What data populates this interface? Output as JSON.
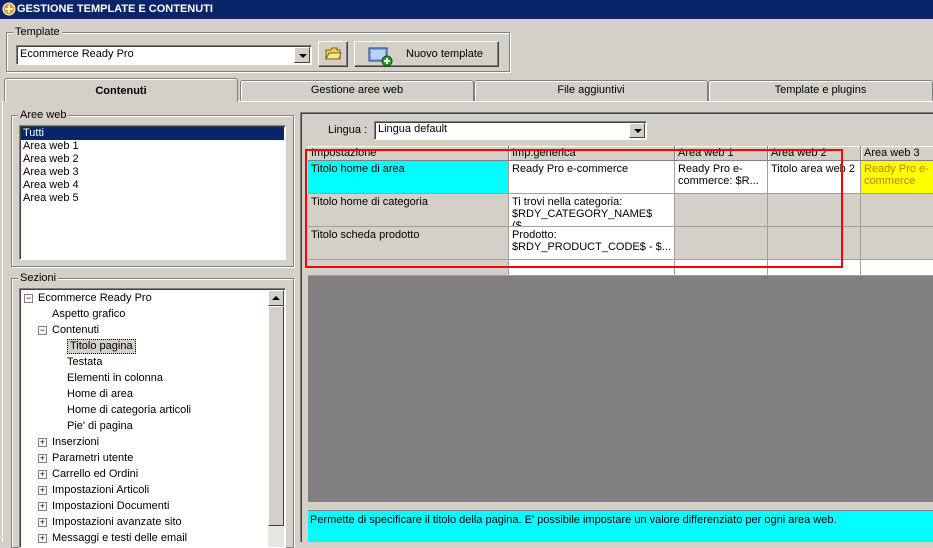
{
  "window": {
    "title": "GESTIONE TEMPLATE E CONTENUTI"
  },
  "template": {
    "group_label": "Template",
    "selected": "Ecommerce Ready Pro",
    "new_button_label": "Nuovo template"
  },
  "tabs": [
    {
      "label": "Contenuti",
      "active": true
    },
    {
      "label": "Gestione aree web",
      "active": false
    },
    {
      "label": "File aggiuntivi",
      "active": false
    },
    {
      "label": "Template e plugins",
      "active": false
    }
  ],
  "aree_web": {
    "group_label": "Aree web",
    "items": [
      "Tutti",
      "Area web 1",
      "Area web 2",
      "Area web 3",
      "Area web 4",
      "Area web 5"
    ],
    "selected_index": 0
  },
  "sezioni": {
    "group_label": "Sezioni",
    "tree": [
      {
        "label": "Ecommerce Ready Pro",
        "level": 0,
        "expander": "−"
      },
      {
        "label": "Aspetto grafico",
        "level": 1,
        "expander": ""
      },
      {
        "label": "Contenuti",
        "level": 1,
        "expander": "−"
      },
      {
        "label": "Titolo pagina",
        "level": 2,
        "expander": "",
        "selected": true
      },
      {
        "label": "Testata",
        "level": 2,
        "expander": ""
      },
      {
        "label": "Elementi in colonna",
        "level": 2,
        "expander": ""
      },
      {
        "label": "Home di area",
        "level": 2,
        "expander": ""
      },
      {
        "label": "Home di categoria articoli",
        "level": 2,
        "expander": ""
      },
      {
        "label": "Pie' di pagina",
        "level": 2,
        "expander": ""
      },
      {
        "label": "Inserzioni",
        "level": 1,
        "expander": "+"
      },
      {
        "label": "Parametri utente",
        "level": 1,
        "expander": "+"
      },
      {
        "label": "Carrello ed Ordini",
        "level": 1,
        "expander": "+"
      },
      {
        "label": "Impostazioni Articoli",
        "level": 1,
        "expander": "+"
      },
      {
        "label": "Impostazioni Documenti",
        "level": 1,
        "expander": "+"
      },
      {
        "label": "Impostazioni avanzate sito",
        "level": 1,
        "expander": "+"
      },
      {
        "label": "Messaggi e testi delle email",
        "level": 1,
        "expander": "+"
      }
    ]
  },
  "lingua": {
    "label": "Lingua :",
    "selected": "Lingua default"
  },
  "grid": {
    "headers": [
      "Impostazione",
      "Imp.generica",
      "Area web 1",
      "Area web 2",
      "Area web 3"
    ],
    "rows": [
      {
        "impostazione": "Titolo home di area",
        "generica": "Ready Pro e-commerce",
        "a1": "Ready Pro e-commerce: $R...",
        "a2": "Titolo area web 2",
        "a3": "Ready Pro e-commerce"
      },
      {
        "impostazione": "Titolo home di categoria",
        "generica": "Ti trovi nella categoria: $RDY_CATEGORY_NAME$ ($...",
        "a1": "",
        "a2": "",
        "a3": ""
      },
      {
        "impostazione": "Titolo scheda prodotto",
        "generica": "Prodotto: $RDY_PRODUCT_CODE$ - $...",
        "a1": "",
        "a2": "",
        "a3": ""
      }
    ]
  },
  "description": "Permette di specificare il titolo della pagina. E' possibile impostare un valore differenziato per ogni area web.",
  "colors": {
    "title_bar": "#0a246a",
    "selected_cell": "#00ffff",
    "area3_highlight": "#ffff00",
    "highlight_rect": "#ff0000",
    "grid_empty_area": "#808080"
  }
}
